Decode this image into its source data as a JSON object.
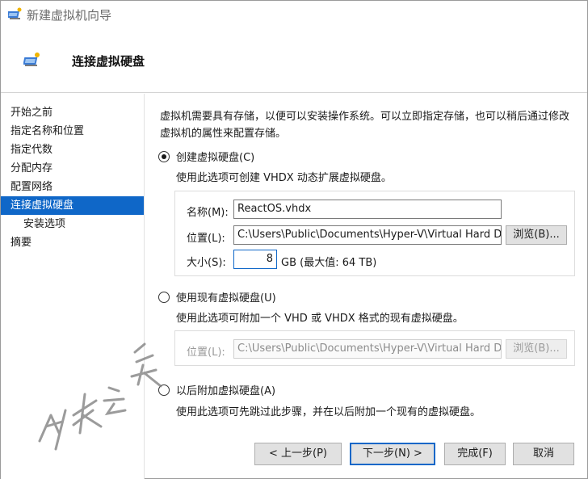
{
  "window": {
    "title": "新建虚拟机向导"
  },
  "header": {
    "title": "连接虚拟硬盘"
  },
  "sidebar": {
    "items": [
      {
        "label": "开始之前"
      },
      {
        "label": "指定名称和位置"
      },
      {
        "label": "指定代数"
      },
      {
        "label": "分配内存"
      },
      {
        "label": "配置网络"
      },
      {
        "label": "连接虚拟硬盘"
      },
      {
        "label": "安装选项"
      },
      {
        "label": "摘要"
      }
    ]
  },
  "content": {
    "description": "虚拟机需要具有存储，以便可以安装操作系统。可以立即指定存储，也可以稍后通过修改虚拟机的属性来配置存储。",
    "option_create": {
      "label": "创建虚拟硬盘(C)",
      "description": "使用此选项可创建 VHDX 动态扩展虚拟硬盘。",
      "name_label": "名称(M):",
      "name_value": "ReactOS.vhdx",
      "location_label": "位置(L):",
      "location_value": "C:\\Users\\Public\\Documents\\Hyper-V\\Virtual Hard Disks\\",
      "browse_label": "浏览(B)...",
      "size_label": "大小(S):",
      "size_value": "8",
      "size_unit": "GB (最大值: 64 TB)"
    },
    "option_existing": {
      "label": "使用现有虚拟硬盘(U)",
      "description": "使用此选项可附加一个 VHD 或 VHDX 格式的现有虚拟硬盘。",
      "location_label": "位置(L):",
      "location_value": "C:\\Users\\Public\\Documents\\Hyper-V\\Virtual Hard Disks\\",
      "browse_label": "浏览(B)..."
    },
    "option_later": {
      "label": "以后附加虚拟硬盘(A)",
      "description": "使用此选项可先跳过此步骤，并在以后附加一个现有的虚拟硬盘。"
    }
  },
  "footer": {
    "prev_label": "< 上一步(P)",
    "next_label": "下一步(N) >",
    "finish_label": "完成(F)",
    "cancel_label": "取消"
  },
  "colors": {
    "accent": "#0f67c8",
    "watermark": "#7a7a7a"
  },
  "icons": {
    "app": "hyper-v-vm-icon",
    "header": "hyper-v-vm-icon"
  }
}
